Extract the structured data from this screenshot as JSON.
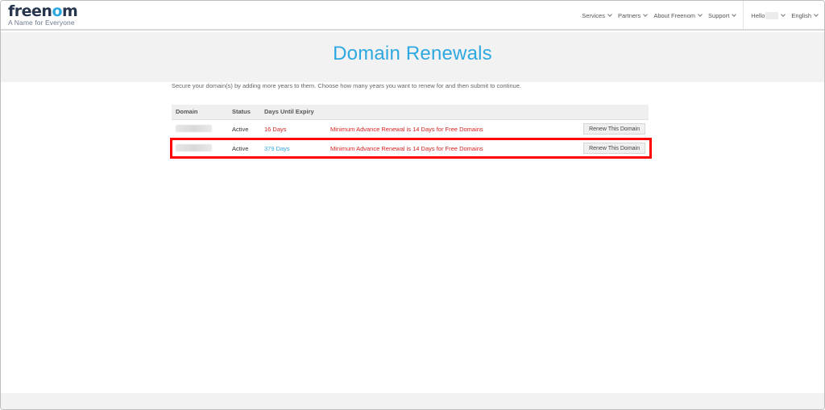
{
  "brand": {
    "name_prefix": "free",
    "name_o": "n",
    "name_highlight": "o",
    "name_suffix": "m",
    "tagline": "A Name for Everyone",
    "color_primary": "#2ea8e0",
    "color_dark": "#27364d"
  },
  "nav": {
    "items": [
      "Services",
      "Partners",
      "About Freenom",
      "Support"
    ],
    "hello": "Hello",
    "language": "English"
  },
  "page": {
    "title": "Domain Renewals",
    "intro": "Secure your domain(s) by adding more years to them. Choose how many years you want to renew for and then submit to continue."
  },
  "table": {
    "headers": [
      "Domain",
      "Status",
      "Days Until Expiry",
      "",
      ""
    ],
    "rows": [
      {
        "domain": "",
        "status": "Active",
        "days": "16 Days",
        "days_color": "red",
        "message": "Minimum Advance Renewal is 14 Days for Free Domains",
        "action": "Renew This Domain"
      },
      {
        "domain": "",
        "status": "Active",
        "days": "379 Days",
        "days_color": "blue",
        "message": "Minimum Advance Renewal is 14 Days for Free Domains",
        "action": "Renew This Domain"
      }
    ]
  },
  "annotation": {
    "highlight_color": "#ff0000",
    "highlighted_row": 2
  }
}
